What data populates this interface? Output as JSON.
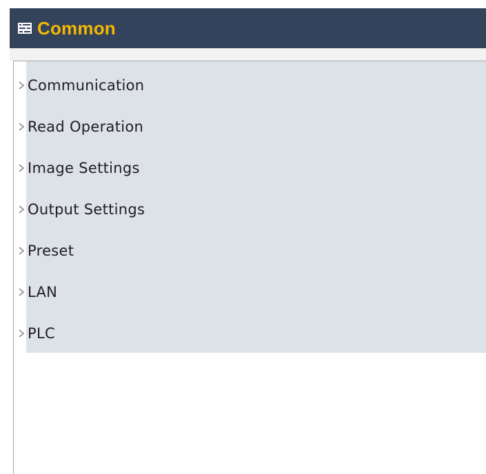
{
  "header": {
    "title": "Common",
    "icon": "list-settings-icon",
    "background_color": "#33435c",
    "title_color": "#f5b800"
  },
  "menu": {
    "background_color": "#dde1e8",
    "items": [
      {
        "label": "Communication",
        "icon": "chevron-right-icon"
      },
      {
        "label": "Read Operation",
        "icon": "chevron-right-icon"
      },
      {
        "label": "Image Settings",
        "icon": "chevron-right-icon"
      },
      {
        "label": "Output Settings",
        "icon": "chevron-right-icon"
      },
      {
        "label": "Preset",
        "icon": "chevron-right-icon"
      },
      {
        "label": "LAN",
        "icon": "chevron-right-icon"
      },
      {
        "label": "PLC",
        "icon": "chevron-right-icon"
      }
    ]
  }
}
